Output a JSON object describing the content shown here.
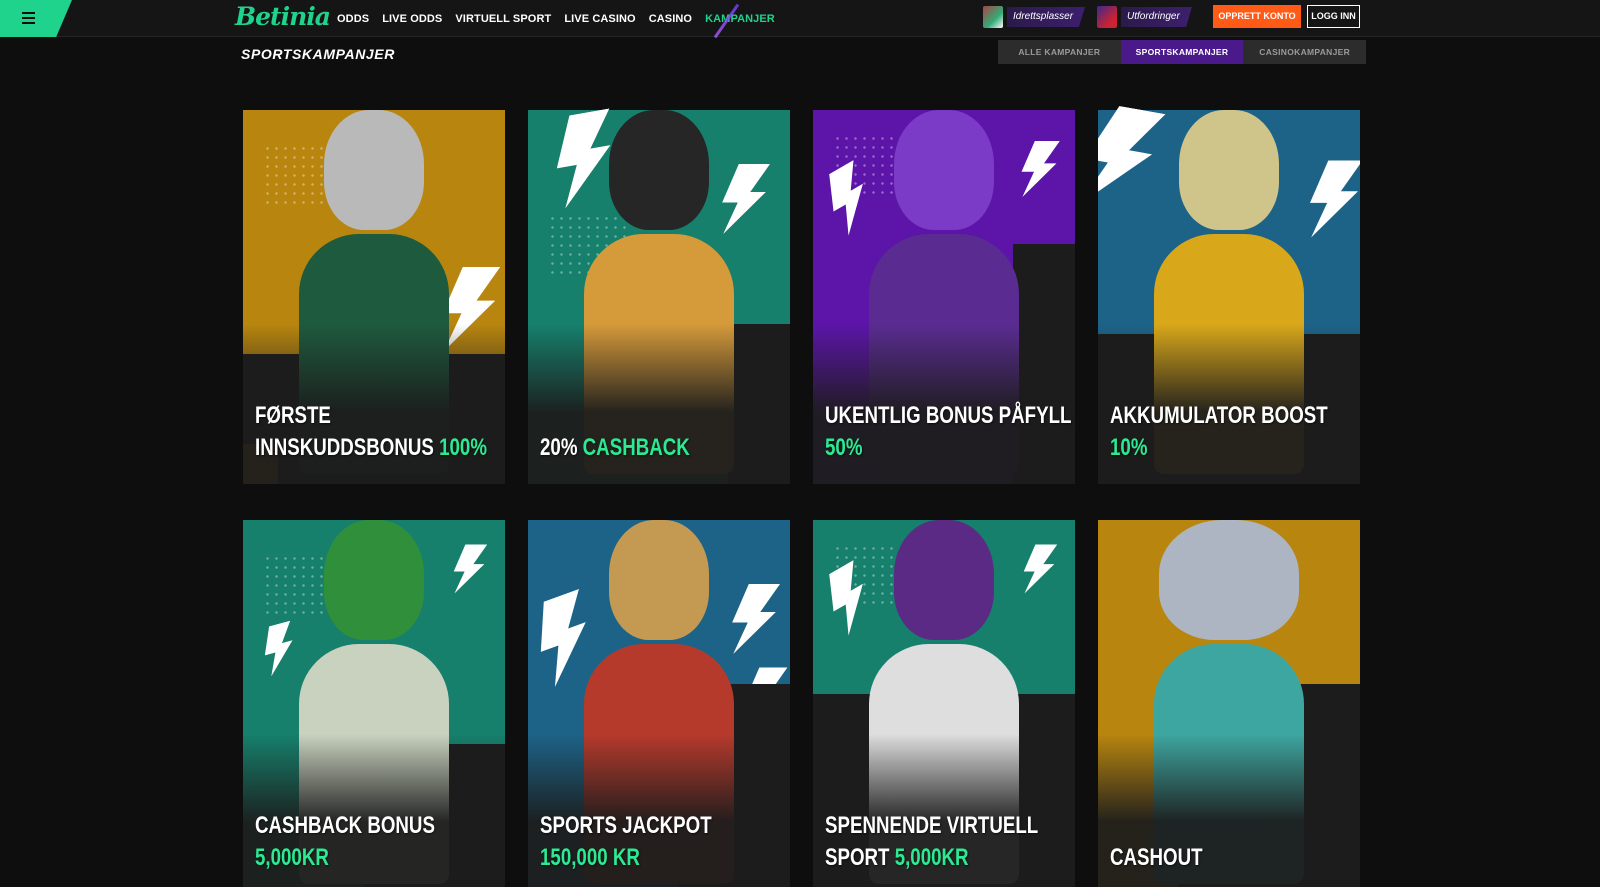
{
  "header": {
    "logo": "Betinia",
    "nav": [
      "ODDS",
      "LIVE ODDS",
      "VIRTUELL SPORT",
      "LIVE CASINO",
      "CASINO",
      "KAMPANJER"
    ],
    "nav_active_index": 5,
    "quick_links": [
      "Idrettsplasser",
      "Utfordringer"
    ],
    "register_label": "OPPRETT KONTO",
    "login_label": "LOGG INN"
  },
  "page": {
    "title": "SPORTSKAMPANJER",
    "tabs": [
      "ALLE KAMPANJER",
      "SPORTSKAMPANJER",
      "CASINOKAMPANJER"
    ],
    "active_tab_index": 1
  },
  "colors": {
    "accent_green": "#1fd38c",
    "highlight_green": "#2bea92",
    "orange": "#ff5a16",
    "purple": "#4a1a8a"
  },
  "promotions": [
    {
      "line1": "FØRSTE",
      "line2_white": "INNSKUDDSBONUS ",
      "line2_green": "100%",
      "animal": "rhino",
      "theme": "mustard"
    },
    {
      "line1": "",
      "line2_white": "20% ",
      "line2_green": "CASHBACK",
      "animal": "panther",
      "theme": "teal"
    },
    {
      "line1": "UKENTLIG BONUS PÅFYLL",
      "line2_white": "",
      "line2_green": "50%",
      "animal": "gorilla",
      "theme": "purple"
    },
    {
      "line1": "AKKUMULATOR BOOST",
      "line2_white": "",
      "line2_green": "10%",
      "animal": "lynx",
      "theme": "blue"
    },
    {
      "line1": "CASHBACK BONUS",
      "line2_white": "",
      "line2_green": "5,000KR",
      "animal": "crocodile",
      "theme": "teal"
    },
    {
      "line1": "SPORTS JACKPOT",
      "line2_white": "",
      "line2_green": "150,000 KR",
      "animal": "stag",
      "theme": "blue"
    },
    {
      "line1": "SPENNENDE VIRTUELL",
      "line2_white": "SPORT ",
      "line2_green": "5,000KR",
      "animal": "bull",
      "theme": "teal"
    },
    {
      "line1": "",
      "line2_white": "CASHOUT",
      "line2_green": "",
      "animal": "elephant",
      "theme": "mustard"
    }
  ]
}
